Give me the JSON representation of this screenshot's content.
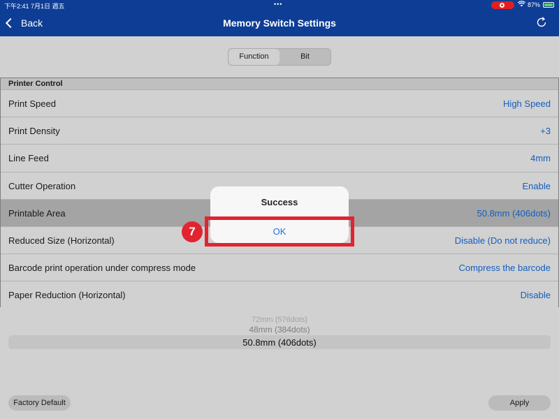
{
  "status_bar": {
    "time": "下午2:41",
    "date": "7月1日 週五",
    "dots": "•••",
    "battery_percent": "87%"
  },
  "nav": {
    "back_label": "Back",
    "title": "Memory Switch Settings",
    "refresh_icon": "refresh-icon"
  },
  "segmented": {
    "options": [
      "Function",
      "Bit"
    ],
    "selected": "Function"
  },
  "section": {
    "header": "Printer Control",
    "rows": [
      {
        "label": "Print Speed",
        "value": "High Speed"
      },
      {
        "label": "Print Density",
        "value": "+3"
      },
      {
        "label": "Line Feed",
        "value": "4mm"
      },
      {
        "label": "Cutter Operation",
        "value": "Enable"
      },
      {
        "label": "Printable Area",
        "value": "50.8mm (406dots)",
        "selected": true
      },
      {
        "label": "Reduced Size (Horizontal)",
        "value": "Disable (Do not reduce)"
      },
      {
        "label": "Barcode print operation under compress mode",
        "value": "Compress the barcode"
      },
      {
        "label": "Paper Reduction (Horizontal)",
        "value": "Disable"
      }
    ]
  },
  "picker": {
    "options": [
      "72mm (576dots)",
      "48mm (384dots)",
      "50.8mm (406dots)"
    ],
    "selected": "50.8mm (406dots)"
  },
  "bottom": {
    "factory_default_label": "Factory Default",
    "apply_label": "Apply"
  },
  "dialog": {
    "title": "Success",
    "ok_label": "OK"
  },
  "annotation": {
    "step_number": "7",
    "highlight_color": "#e22330"
  },
  "colors": {
    "nav_bar": "#0e3d95",
    "accent": "#1a73e8"
  }
}
